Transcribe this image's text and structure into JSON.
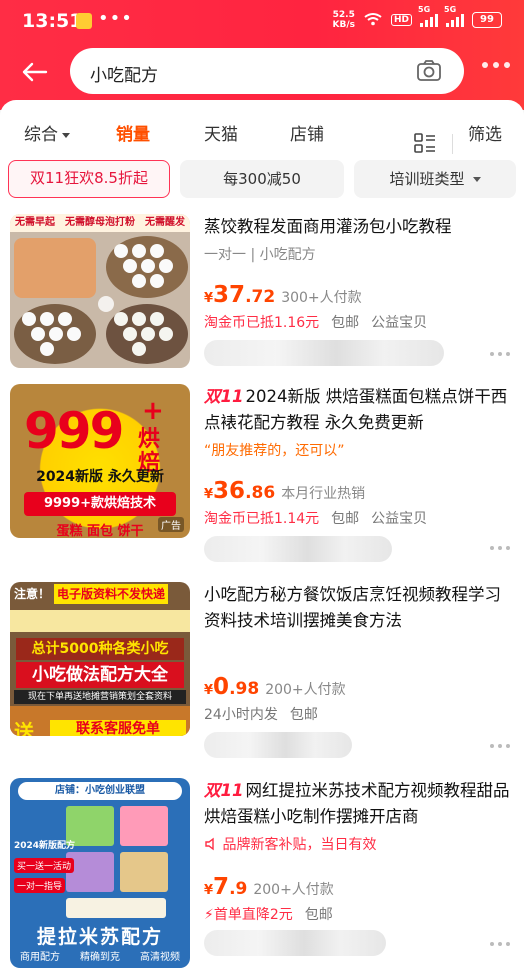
{
  "status": {
    "time": "13:51",
    "net_speed": "52.5",
    "net_unit": "KB/s",
    "hd": "HD",
    "signal1": "5G",
    "signal2": "5G",
    "battery": "99"
  },
  "search": {
    "query": "小吃配方"
  },
  "sort_tabs": [
    {
      "label": "综合",
      "active": false
    },
    {
      "label": "销量",
      "active": true
    },
    {
      "label": "天猫",
      "active": false
    },
    {
      "label": "店铺",
      "active": false
    }
  ],
  "filter_label": "筛选",
  "chips": [
    "双11狂欢8.5折起",
    "每300减50",
    "培训班类型"
  ],
  "products": [
    {
      "title": "蒸饺教程发面商用灌汤包小吃教程",
      "sub": "一对一 | 小吃配方",
      "price_int": "37",
      "price_dec": ".72",
      "sales": "300+人付款",
      "promo": "淘金币已抵1.16元",
      "tags": [
        "包邮",
        "公益宝贝"
      ]
    },
    {
      "tag11": "双11",
      "title": "2024新版 烘焙蛋糕面包糕点饼干西点裱花配方教程 永久免费更新",
      "quote": "“朋友推荐的，还可以”",
      "price_int": "36",
      "price_dec": ".86",
      "sales": "本月行业热销",
      "promo": "淘金币已抵1.14元",
      "tags": [
        "包邮",
        "公益宝贝"
      ],
      "ad": "广告"
    },
    {
      "title": "小吃配方秘方餐饮饭店烹饪视频教程学习资料技术培训摆摊美食方法",
      "price_int": "0",
      "price_dec": ".98",
      "sales": "200+人付款",
      "promo": "24小时内发",
      "tags": [
        "包邮"
      ]
    },
    {
      "tag11": "双11",
      "title": "网红提拉米苏技术配方视频教程甜品烘焙蛋糕小吃制作摆摊开店商",
      "notice": "品牌新客补贴，当日有效",
      "price_int": "7",
      "price_dec": ".9",
      "sales": "200+人付款",
      "promo": "首单直降2元",
      "tags": [
        "包邮"
      ]
    }
  ],
  "thumb_text": {
    "p1": [
      "无需早起",
      "无需醇母泡打粉",
      "无需醒发"
    ],
    "p2": [
      "999",
      "烘焙",
      "2024新版 永久更新",
      "9999+款烘焙技术",
      "蛋糕 面包 饼干"
    ],
    "p3": [
      "注意！",
      "电子版资料不发快递",
      "总计5000种各类小吃",
      "小吃做法配方大全",
      "现在下单再送地摊营销策划全套资料",
      "送",
      "联系客服免单"
    ],
    "p4": [
      "店铺：小吃创业联盟",
      "2024新版配方",
      "买一送一活动",
      "一对一指导",
      "提拉米苏配方",
      "商用配方",
      "精确到克",
      "高清视频"
    ]
  },
  "colors": {
    "brand_red": "#ff2440",
    "price_orange": "#ff4400",
    "active_sort": "#ff5000"
  }
}
